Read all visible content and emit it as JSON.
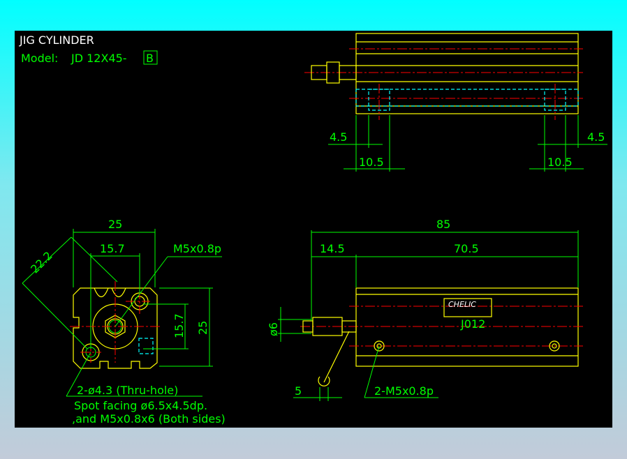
{
  "title": "JIG CYLINDER",
  "model_label": "Model:",
  "model_value": "JD 12X45-",
  "model_suffix": "B",
  "top_view": {
    "dim_left_a": "4.5",
    "dim_left_b": "10.5",
    "dim_right_a": "4.5",
    "dim_right_b": "10.5"
  },
  "front_view": {
    "dim_width": "25",
    "dim_diag": "22.2",
    "dim_inner": "15.7",
    "dim_port": "M5x0.8p",
    "dim_v_inner": "15.7",
    "dim_v_outer": "25",
    "note_holes": "2-ø4.3 (Thru-hole)",
    "note_spot": "Spot facing ø6.5x4.5dp.",
    "note_tap": ",and M5x0.8x6 (Both sides)"
  },
  "side_view": {
    "dim_total": "85",
    "dim_rod": "14.5",
    "dim_body": "70.5",
    "dim_dia": "ø6",
    "dim_wrench": "5",
    "dim_ports": "2-M5x0.8p",
    "brand": "CHELIC",
    "part_code": "J012"
  },
  "colors": {
    "outline": "#ffff00",
    "dimension": "#00ff00",
    "center": "#ff0000",
    "hidden": "#00ffff"
  }
}
